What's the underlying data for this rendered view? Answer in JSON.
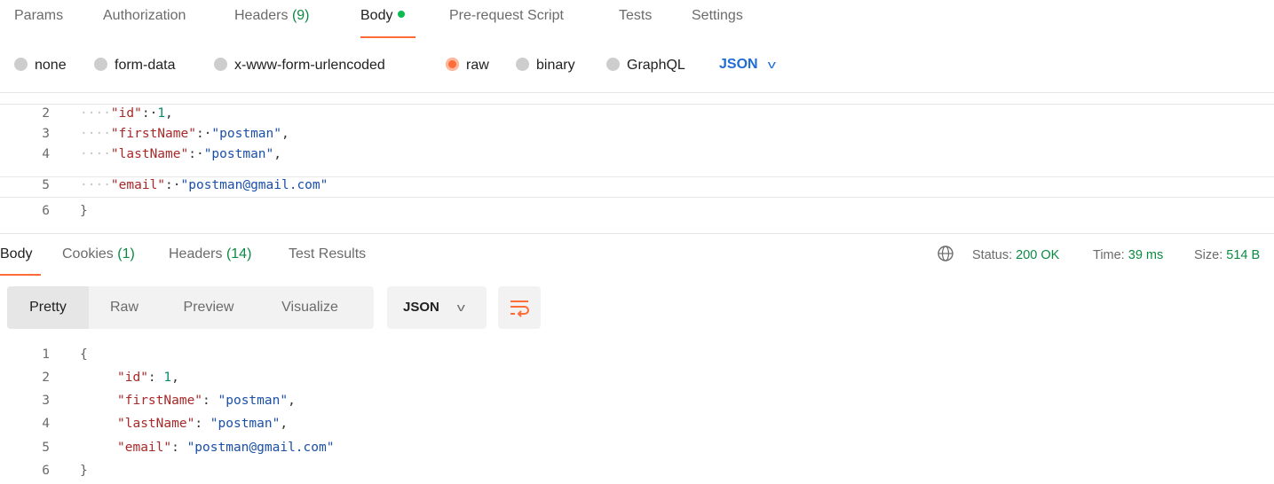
{
  "request_tabs": {
    "params": "Params",
    "authorization": "Authorization",
    "headers_label": "Headers",
    "headers_count": "(9)",
    "body": "Body",
    "pre_request": "Pre-request Script",
    "tests": "Tests",
    "settings": "Settings"
  },
  "body_modes": {
    "none": "none",
    "form_data": "form-data",
    "urlencoded": "x-www-form-urlencoded",
    "raw": "raw",
    "binary": "binary",
    "graphql": "GraphQL",
    "selected": "raw",
    "language": "JSON"
  },
  "request_body": {
    "lines": [
      {
        "n": "2",
        "indent": "····",
        "key": "\"id\"",
        "sep": ":·",
        "value": "1",
        "value_type": "number",
        "trail": ","
      },
      {
        "n": "3",
        "indent": "····",
        "key": "\"firstName\"",
        "sep": ":·",
        "value": "\"postman\"",
        "value_type": "string",
        "trail": ","
      },
      {
        "n": "4",
        "indent": "····",
        "key": "\"lastName\"",
        "sep": ":·",
        "value": "\"postman\"",
        "value_type": "string",
        "trail": ","
      },
      {
        "n": "5",
        "indent": "····",
        "key": "\"email\"",
        "sep": ":·",
        "value": "\"postman@gmail.com\"",
        "value_type": "string",
        "trail": ""
      },
      {
        "n": "6",
        "brace": "}"
      }
    ]
  },
  "response_tabs": {
    "body": "Body",
    "cookies_label": "Cookies",
    "cookies_count": "(1)",
    "headers_label": "Headers",
    "headers_count": "(14)",
    "test_results": "Test Results"
  },
  "response_meta": {
    "status_label": "Status:",
    "status_value": "200 OK",
    "time_label": "Time:",
    "time_value": "39 ms",
    "size_label": "Size:",
    "size_value": "514 B"
  },
  "response_view": {
    "pretty": "Pretty",
    "raw": "Raw",
    "preview": "Preview",
    "visualize": "Visualize",
    "format": "JSON"
  },
  "response_body": {
    "open_brace": "{",
    "close_brace": "}",
    "lines": [
      {
        "n": "2",
        "key": "\"id\"",
        "sep": ": ",
        "value": "1",
        "value_type": "number",
        "trail": ","
      },
      {
        "n": "3",
        "key": "\"firstName\"",
        "sep": ": ",
        "value": "\"postman\"",
        "value_type": "string",
        "trail": ","
      },
      {
        "n": "4",
        "key": "\"lastName\"",
        "sep": ": ",
        "value": "\"postman\"",
        "value_type": "string",
        "trail": ","
      },
      {
        "n": "5",
        "key": "\"email\"",
        "sep": ": ",
        "value": "\"postman@gmail.com\"",
        "value_type": "string",
        "trail": ""
      }
    ],
    "first_line": "1",
    "last_line": "6"
  },
  "colors": {
    "accent": "#ff6c37",
    "success": "#0c8a43",
    "link": "#1f6cd6"
  }
}
